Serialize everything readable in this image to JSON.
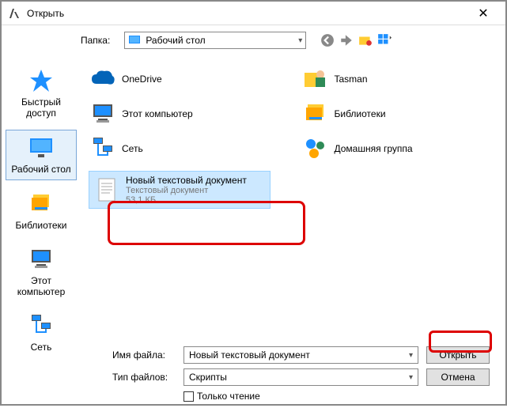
{
  "window": {
    "title": "Открыть"
  },
  "folder": {
    "label": "Папка:",
    "current": "Рабочий стол"
  },
  "sidebar": {
    "items": [
      {
        "label": "Быстрый доступ"
      },
      {
        "label": "Рабочий стол"
      },
      {
        "label": "Библиотеки"
      },
      {
        "label": "Этот компьютер"
      },
      {
        "label": "Сеть"
      }
    ]
  },
  "items": {
    "onedrive": "OneDrive",
    "tasman": "Tasman",
    "thispc": "Этот компьютер",
    "libraries": "Библиотеки",
    "network": "Сеть",
    "homegroup": "Домашняя группа",
    "file": {
      "name": "Новый текстовый документ",
      "type": "Текстовый документ",
      "size": "53,1 КБ"
    }
  },
  "controls": {
    "filename_label": "Имя файла:",
    "filename_value": "Новый текстовый документ",
    "filetype_label": "Тип файлов:",
    "filetype_value": "Скрипты",
    "readonly": "Только чтение",
    "open": "Открыть",
    "cancel": "Отмена"
  }
}
